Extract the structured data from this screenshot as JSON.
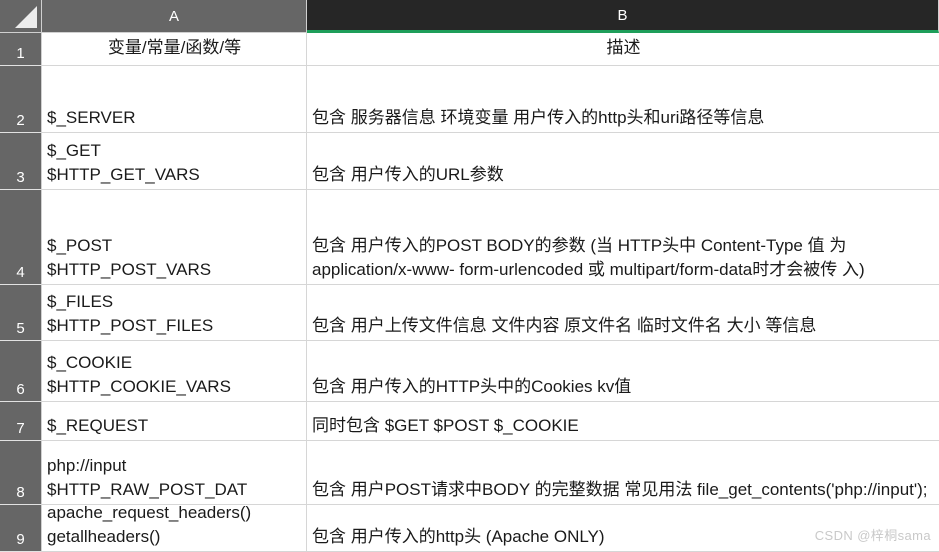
{
  "app": {
    "type": "spreadsheet",
    "select_all_icon": "select-all-triangle-icon"
  },
  "colors": {
    "header_bg": "#666666",
    "header_selected_bg": "#262626",
    "accent_green": "#1e9e5a",
    "gridline": "#d6d6d6",
    "cell_bg": "#ffffff",
    "text": "#1a1a1a",
    "watermark": "#c9c9c9"
  },
  "columns": [
    {
      "id": "A",
      "label": "A",
      "selected": false
    },
    {
      "id": "B",
      "label": "B",
      "selected": true
    }
  ],
  "rows": [
    {
      "number": "1"
    },
    {
      "number": "2"
    },
    {
      "number": "3"
    },
    {
      "number": "4"
    },
    {
      "number": "5"
    },
    {
      "number": "6"
    },
    {
      "number": "7"
    },
    {
      "number": "8"
    },
    {
      "number": "9"
    }
  ],
  "headers": {
    "a": "变量/常量/函数/等",
    "b": "描述"
  },
  "table": [
    {
      "row": "2",
      "a": "$_SERVER",
      "b": "包含 服务器信息 环境变量 用户传入的http头和uri路径等信息"
    },
    {
      "row": "3",
      "a": "$_GET\n$HTTP_GET_VARS",
      "b": "包含 用户传入的URL参数"
    },
    {
      "row": "4",
      "a": "$_POST\n$HTTP_POST_VARS",
      "b": "包含 用户传入的POST BODY的参数 (当 HTTP头中 Content-Type 值 为 application/x-www- form-urlencoded 或 multipart/form-data时才会被传 入)"
    },
    {
      "row": "5",
      "a": "$_FILES\n$HTTP_POST_FILES",
      "b": "包含 用户上传文件信息 文件内容 原文件名 临时文件名 大小 等信息"
    },
    {
      "row": "6",
      "a": "$_COOKIE\n$HTTP_COOKIE_VARS",
      "b": "包含 用户传入的HTTP头中的Cookies kv值"
    },
    {
      "row": "7",
      "a": "$_REQUEST",
      "b": "同时包含 $GET $POST $_COOKIE"
    },
    {
      "row": "8",
      "a": "php://input\n$HTTP_RAW_POST_DAT",
      "b": "包含 用户POST请求中BODY 的完整数据 常见用法 file_get_contents('php://input');"
    },
    {
      "row": "9",
      "a": "apache_request_headers() getallheaders()",
      "b": "包含 用户传入的http头 (Apache ONLY)"
    }
  ],
  "watermark": "CSDN @梓桐sama"
}
